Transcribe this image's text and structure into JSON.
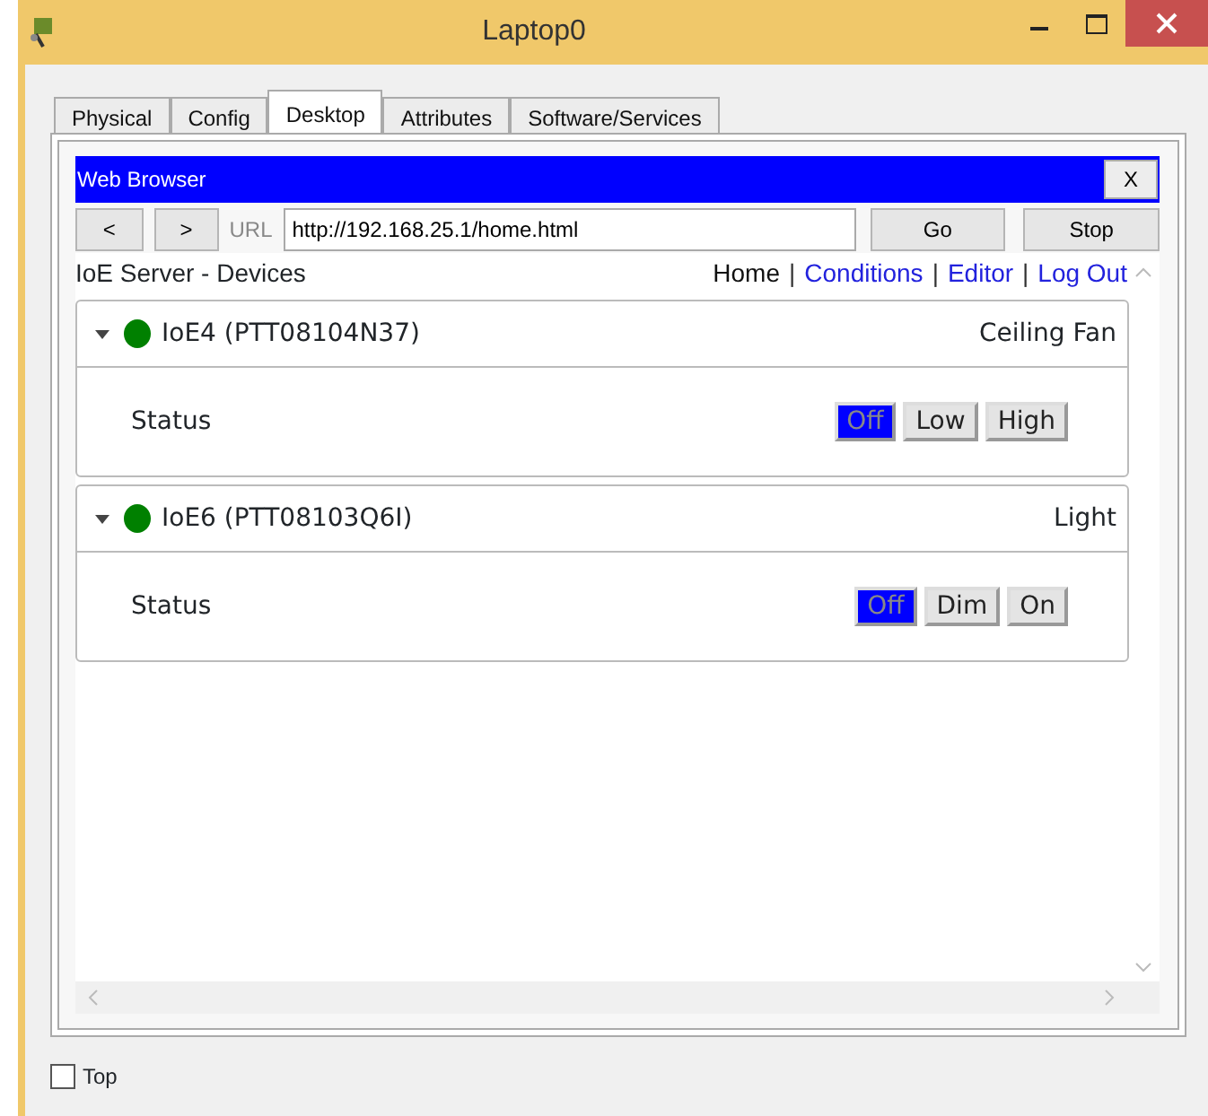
{
  "window": {
    "title": "Laptop0"
  },
  "tabs": [
    {
      "label": "Physical",
      "selected": false
    },
    {
      "label": "Config",
      "selected": false
    },
    {
      "label": "Desktop",
      "selected": true
    },
    {
      "label": "Attributes",
      "selected": false
    },
    {
      "label": "Software/Services",
      "selected": false
    }
  ],
  "browser": {
    "title": "Web Browser",
    "close": "X",
    "back": "<",
    "forward": ">",
    "url_label": "URL",
    "url": "http://192.168.25.1/home.html",
    "go": "Go",
    "stop": "Stop"
  },
  "page": {
    "heading": "IoE Server - Devices",
    "nav": [
      {
        "label": "Home",
        "kind": "current"
      },
      {
        "label": "|",
        "kind": "separator"
      },
      {
        "label": "Conditions",
        "kind": "link"
      },
      {
        "label": "|",
        "kind": "separator"
      },
      {
        "label": "Editor",
        "kind": "link"
      },
      {
        "label": "|",
        "kind": "separator"
      },
      {
        "label": "Log Out",
        "kind": "link"
      }
    ],
    "devices": [
      {
        "name": "IoE4 (PTT08104N37)",
        "type": "Ceiling Fan",
        "color": "#008000",
        "expanded": true,
        "status_label": "Status",
        "options": [
          {
            "label": "Off",
            "selected": true
          },
          {
            "label": "Low",
            "selected": false
          },
          {
            "label": "High",
            "selected": false
          }
        ]
      },
      {
        "name": "IoE6 (PTT08103Q6I)",
        "type": "Light",
        "color": "#008000",
        "expanded": true,
        "status_label": "Status",
        "options": [
          {
            "label": "Off",
            "selected": true
          },
          {
            "label": "Dim",
            "selected": false
          },
          {
            "label": "On",
            "selected": false
          }
        ]
      }
    ]
  },
  "top_checkbox": {
    "label": "Top",
    "checked": false
  }
}
